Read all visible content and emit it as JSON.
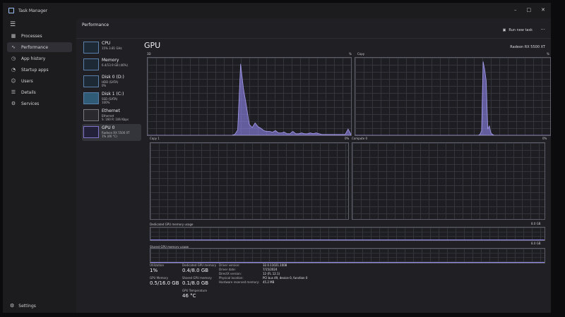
{
  "window": {
    "title": "Task Manager",
    "controls": {
      "minimize": "–",
      "maximize": "□",
      "close": "✕"
    }
  },
  "nav": {
    "items": [
      {
        "label": "Processes",
        "icon": "grid-icon",
        "glyph": "▦"
      },
      {
        "label": "Performance",
        "icon": "pulse-icon",
        "glyph": "∿"
      },
      {
        "label": "App history",
        "icon": "clock-icon",
        "glyph": "◷"
      },
      {
        "label": "Startup apps",
        "icon": "speedometer-icon",
        "glyph": "◔"
      },
      {
        "label": "Users",
        "icon": "users-icon",
        "glyph": "☺"
      },
      {
        "label": "Details",
        "icon": "list-icon",
        "glyph": "☰"
      },
      {
        "label": "Services",
        "icon": "puzzle-icon",
        "glyph": "⚙"
      }
    ],
    "settings_label": "Settings"
  },
  "header": {
    "title": "Performance",
    "run_new_task": "Run new task",
    "more": "···"
  },
  "resources": [
    {
      "title": "CPU",
      "sub": [
        "15% 3.81 GHz"
      ]
    },
    {
      "title": "Memory",
      "sub": [
        "6.4/13.9 GB (46%)"
      ]
    },
    {
      "title": "Disk 0 (D:)",
      "sub": [
        "HDD (SATA)",
        "0%"
      ]
    },
    {
      "title": "Disk 1 (C:)",
      "sub": [
        "SSD (SATA)",
        "100%"
      ]
    },
    {
      "title": "Ethernet",
      "sub": [
        "Ethernet",
        "S: 160 R: 106 Kbps"
      ]
    },
    {
      "title": "GPU 0",
      "sub": [
        "Radeon RX 5500 XT",
        "1% (46 °C)"
      ]
    }
  ],
  "gpu": {
    "title": "GPU",
    "model": "Radeon RX 5500 XT",
    "graphs": [
      {
        "name": "3D",
        "max": "%",
        "usage_percent": [
          0,
          0,
          0,
          0,
          0,
          0,
          0,
          0,
          0,
          0,
          0,
          0,
          0,
          0,
          0,
          0,
          0,
          0,
          0,
          0,
          0,
          0,
          0,
          0,
          0,
          0,
          0,
          0,
          0,
          0,
          1,
          7,
          92,
          60,
          38,
          14,
          10,
          16,
          11,
          9,
          6,
          5,
          5,
          4,
          6,
          3,
          3,
          4,
          2,
          2,
          5,
          2,
          2,
          3,
          2,
          2,
          3,
          2,
          3,
          2,
          1,
          1,
          1,
          1,
          1,
          1,
          1,
          1,
          1,
          8,
          1
        ]
      },
      {
        "name": "Copy",
        "max": "%",
        "usage_percent": [
          0,
          0,
          0,
          0,
          0,
          0,
          0,
          0,
          0,
          0,
          0,
          0,
          0,
          0,
          0,
          0,
          0,
          0,
          0,
          0,
          0,
          0,
          0,
          0,
          0,
          0,
          0,
          0,
          0,
          0,
          0,
          0,
          0,
          0,
          0,
          0,
          0,
          0,
          0,
          0,
          0,
          0,
          0,
          0,
          0,
          0,
          0,
          0,
          0,
          0,
          0,
          0,
          0,
          0,
          0,
          0,
          0,
          0,
          0,
          0,
          0,
          0,
          0,
          0,
          0,
          0,
          0,
          0,
          0,
          0,
          0,
          0,
          0,
          0,
          0,
          0,
          0,
          0,
          0,
          0,
          1,
          6,
          95,
          85,
          70,
          8,
          12,
          3,
          1,
          0,
          0,
          0,
          0,
          0,
          0,
          0,
          0,
          0,
          0,
          0,
          0,
          0,
          0,
          0,
          0,
          0,
          0,
          0,
          0,
          0,
          0,
          0,
          0,
          0,
          0,
          0,
          0,
          0,
          0,
          0,
          0,
          0,
          0,
          0,
          0,
          0
        ]
      },
      {
        "name": "Copy 1",
        "max": "0%",
        "usage_percent": []
      },
      {
        "name": "Compute 0",
        "max": "0%",
        "usage_percent": []
      }
    ],
    "dedicated_memory_graph": {
      "label": "Dedicated GPU memory usage",
      "max": "8.0 GB",
      "level_fraction": 0.05
    },
    "shared_memory_graph": {
      "label": "Shared GPU memory usage",
      "max": "8.0 GB",
      "level_fraction": 0.06
    },
    "stats": {
      "utilization": {
        "label": "Utilization",
        "value": "1%"
      },
      "dedicated_gpu_memory": {
        "label": "Dedicated GPU memory",
        "value": "0.4/8.0 GB"
      },
      "gpu_memory": {
        "label": "GPU Memory",
        "value": "0.5/16.0 GB"
      },
      "shared_gpu_memory": {
        "label": "Shared GPU memory",
        "value": "0.1/8.0 GB"
      },
      "gpu_temperature": {
        "label": "GPU Temperature",
        "value": "46 °C"
      }
    },
    "details": [
      {
        "label": "Driver version:",
        "value": "32.0.11021.1008"
      },
      {
        "label": "Driver date:",
        "value": "7/15/2024"
      },
      {
        "label": "DirectX version:",
        "value": "12 (FL 12.1)"
      },
      {
        "label": "Physical location:",
        "value": "PCI bus 49, device 0, function 0"
      },
      {
        "label": "Hardware reserved memory:",
        "value": "45.2 MB"
      }
    ]
  }
}
